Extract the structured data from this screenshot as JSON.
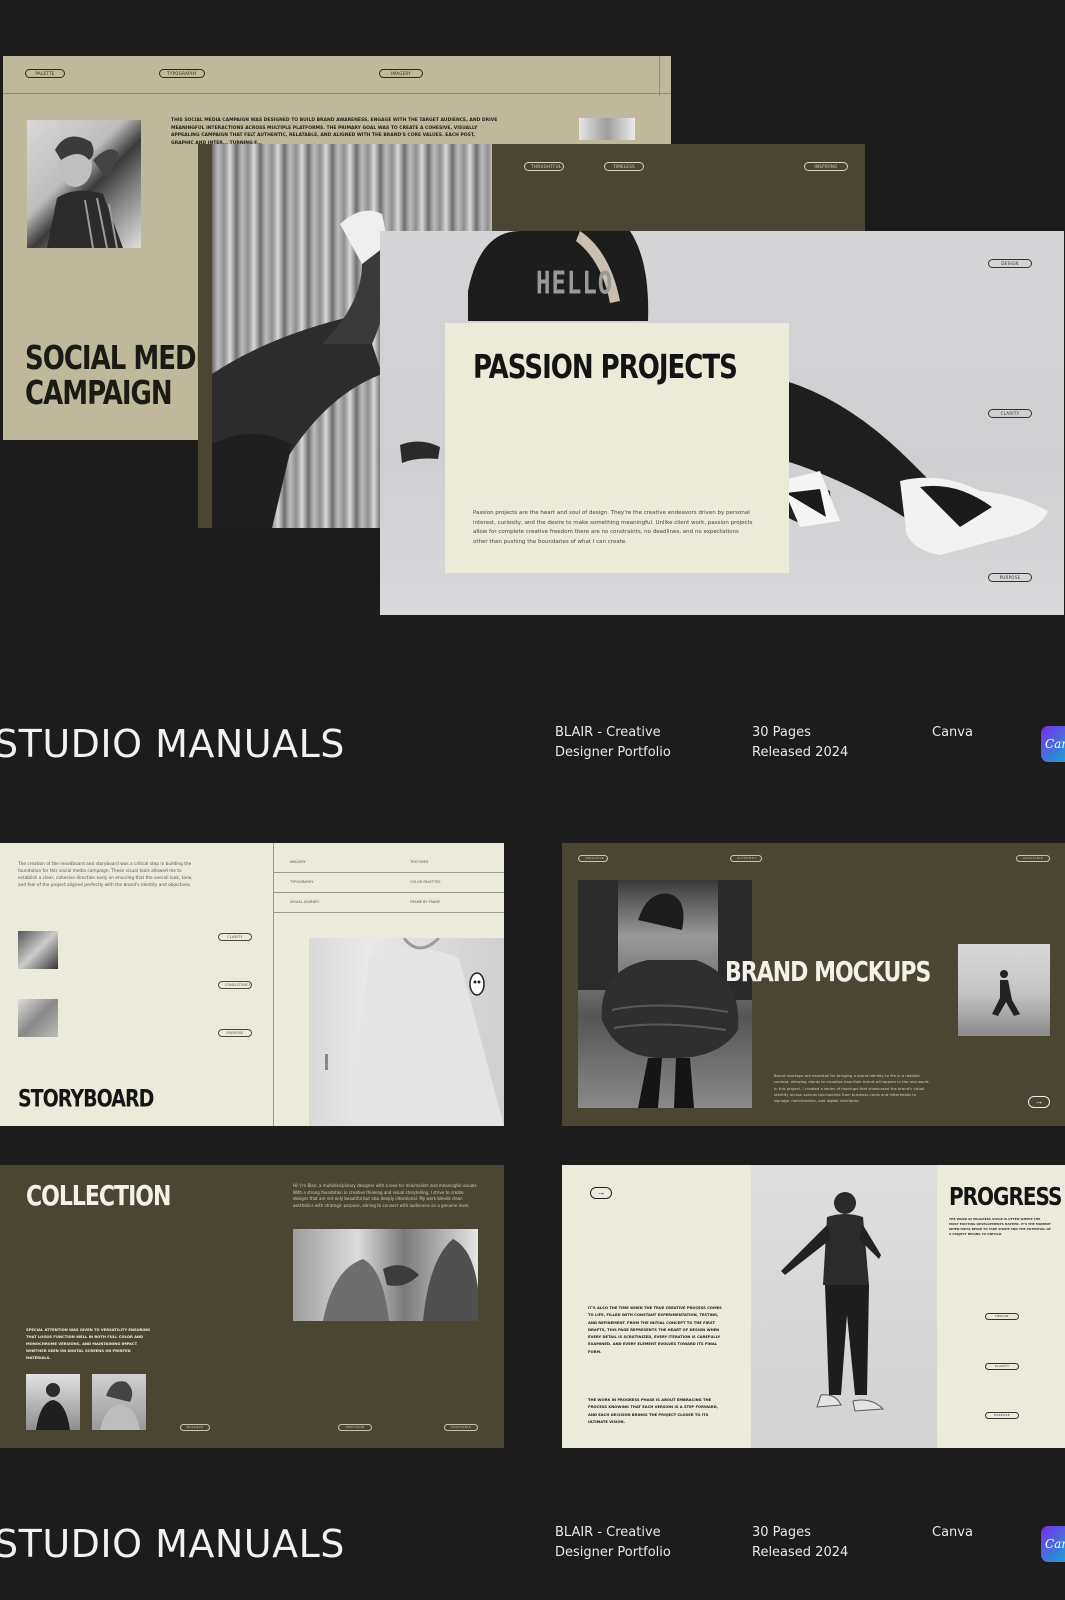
{
  "colors": {
    "background": "#1c1c1c",
    "khaki": "#bfb89b",
    "olive": "#4b4634",
    "cream": "#eceadb"
  },
  "hero": {
    "social": {
      "pills": [
        "PALETTE",
        "TYPOGRAPHY",
        "IMAGERY"
      ],
      "body": "THIS SOCIAL MEDIA CAMPAIGN WAS DESIGNED TO BUILD BRAND AWARENESS, ENGAGE WITH THE TARGET AUDIENCE, AND DRIVE MEANINGFUL INTERACTIONS ACROSS MULTIPLE PLATFORMS. THE PRIMARY GOAL WAS TO CREATE A COHESIVE, VISUALLY APPEALING CAMPAIGN THAT FELT AUTHENTIC, RELATABLE, AND ALIGNED WITH THE BRAND'S CORE VALUES. EACH POST, GRAPHIC AND INTER... TURNING F...",
      "title_line1": "SOCIAL MEDIA",
      "title_line2": "CAMPAIGN"
    },
    "middle": {
      "pills": [
        "THOUGHTFUL",
        "TIMELESS",
        "INSPIRING"
      ]
    },
    "passion": {
      "pills": [
        "DESIGN",
        "CLARITY",
        "PURPOSE"
      ],
      "sweatshirt_text": "HELLO",
      "title": "PASSION PROJECTS",
      "body": "Passion projects are the heart and soul of design. They're the creative endeavors driven by personal interest, curiosity, and the desire to make something meaningful. Unlike client work, passion projects allow for complete creative freedom there are no constraints, no deadlines, and no expectations other than pushing the boundaries of what I can create."
    }
  },
  "band1": {
    "title": "STUDIO MANUALS",
    "product_line1": "BLAIR - Creative",
    "product_line2": "Designer Portfolio",
    "pages_line1": "30 Pages",
    "pages_line2": "Released 2024",
    "platform": "Canva",
    "badge": "Canva"
  },
  "storyboard": {
    "intro": "The creation of the moodboard and storyboard was a critical step in building the foundation for this social media campaign. These visual tools allowed me to establish a clear, cohesive direction early on ensuring that the overall look, tone, and feel of the project aligned perfectly with the brand's identity and objectives.",
    "grid": [
      [
        "IMAGERY",
        "TEXTURES"
      ],
      [
        "TYPOGRAPHY",
        "COLOR PALETTES"
      ],
      [
        "VISUAL JOURNEY",
        "FRAME BY FRAME"
      ]
    ],
    "pills": [
      "CLARITY",
      "CONSISTENCY",
      "PURPOSE"
    ],
    "title": "STORYBOARD"
  },
  "mockups": {
    "pills": [
      "VERSATILE",
      "AUTHENTIC",
      "ADAPTABLE"
    ],
    "title": "BRAND MOCKUPS",
    "body": "Brand mockups are essential for bringing a brand identity to life in a realistic context, allowing clients to visualize how their brand will appear in the real world. In this project, I created a series of mockups that showcased the brand's visual identity across various touchpoints from business cards and letterheads to signage, merchandise, and digital interfaces.",
    "arrow": "→"
  },
  "collection": {
    "title": "COLLECTION",
    "intro": "Hi! I'm Blair, a multidisciplinary designer with a love for minimalism and meaningful visuals. With a strong foundation in creative thinking and visual storytelling, I strive to create designs that are not only beautiful but also deeply intentional. My work blends clean aesthetics with strategic purpose, aiming to connect with audiences on a genuine level.",
    "body": "SPECIAL ATTENTION WAS GIVEN TO VERSATILITY ENSURING THAT LOGOS FUNCTION WELL IN BOTH FULL COLOR AND MONOCHROME VERSIONS, AND MAINTAINING IMPACT WHETHER SEEN ON DIGITAL SCREENS OR PRINTED MATERIALS.",
    "pills": [
      "BALANCE",
      "PRECISION",
      "ADAPTABLE"
    ]
  },
  "progress": {
    "arrow": "→",
    "body1": "IT'S ALSO THE TIME WHEN THE TRUE CREATIVE PROCESS COMES TO LIFE, FILLED WITH CONSTANT EXPERIMENTATION, TESTING, AND REFINEMENT. FROM THE INITIAL CONCEPT TO THE FIRST DRAFTS, THIS PAGE REPRESENTS THE HEART OF DESIGN WHEN EVERY DETAIL IS SCRUTINIZED, EVERY ITERATION IS CAREFULLY EXAMINED, AND EVERY ELEMENT EVOLVES TOWARD ITS FINAL FORM.",
    "body2": "THE WORK IN PROGRESS PHASE IS ABOUT EMBRACING THE PROCESS KNOWING THAT EACH VERSION IS A STEP FORWARD, AND EACH DECISION BRINGS THE PROJECT CLOSER TO ITS ULTIMATE VISION.",
    "title": "PROGRESS",
    "side": "THE WORK IN PROGRESS STAGE IS OFTEN WHERE THE MOST EXCITING DEVELOPMENTS HAPPEN. IT'S THE MOMENT WHEN IDEAS BEGIN TO TAKE SHAPE AND THE POTENTIAL OF A PROJECT BEGINS TO UNFOLD.",
    "pills": [
      "DESIGN",
      "CLARITY",
      "PURPOSE"
    ]
  },
  "band2": {
    "title": "STUDIO MANUALS",
    "product_line1": "BLAIR - Creative",
    "product_line2": "Designer Portfolio",
    "pages_line1": "30 Pages",
    "pages_line2": "Released 2024",
    "platform": "Canva",
    "badge": "Canva"
  }
}
